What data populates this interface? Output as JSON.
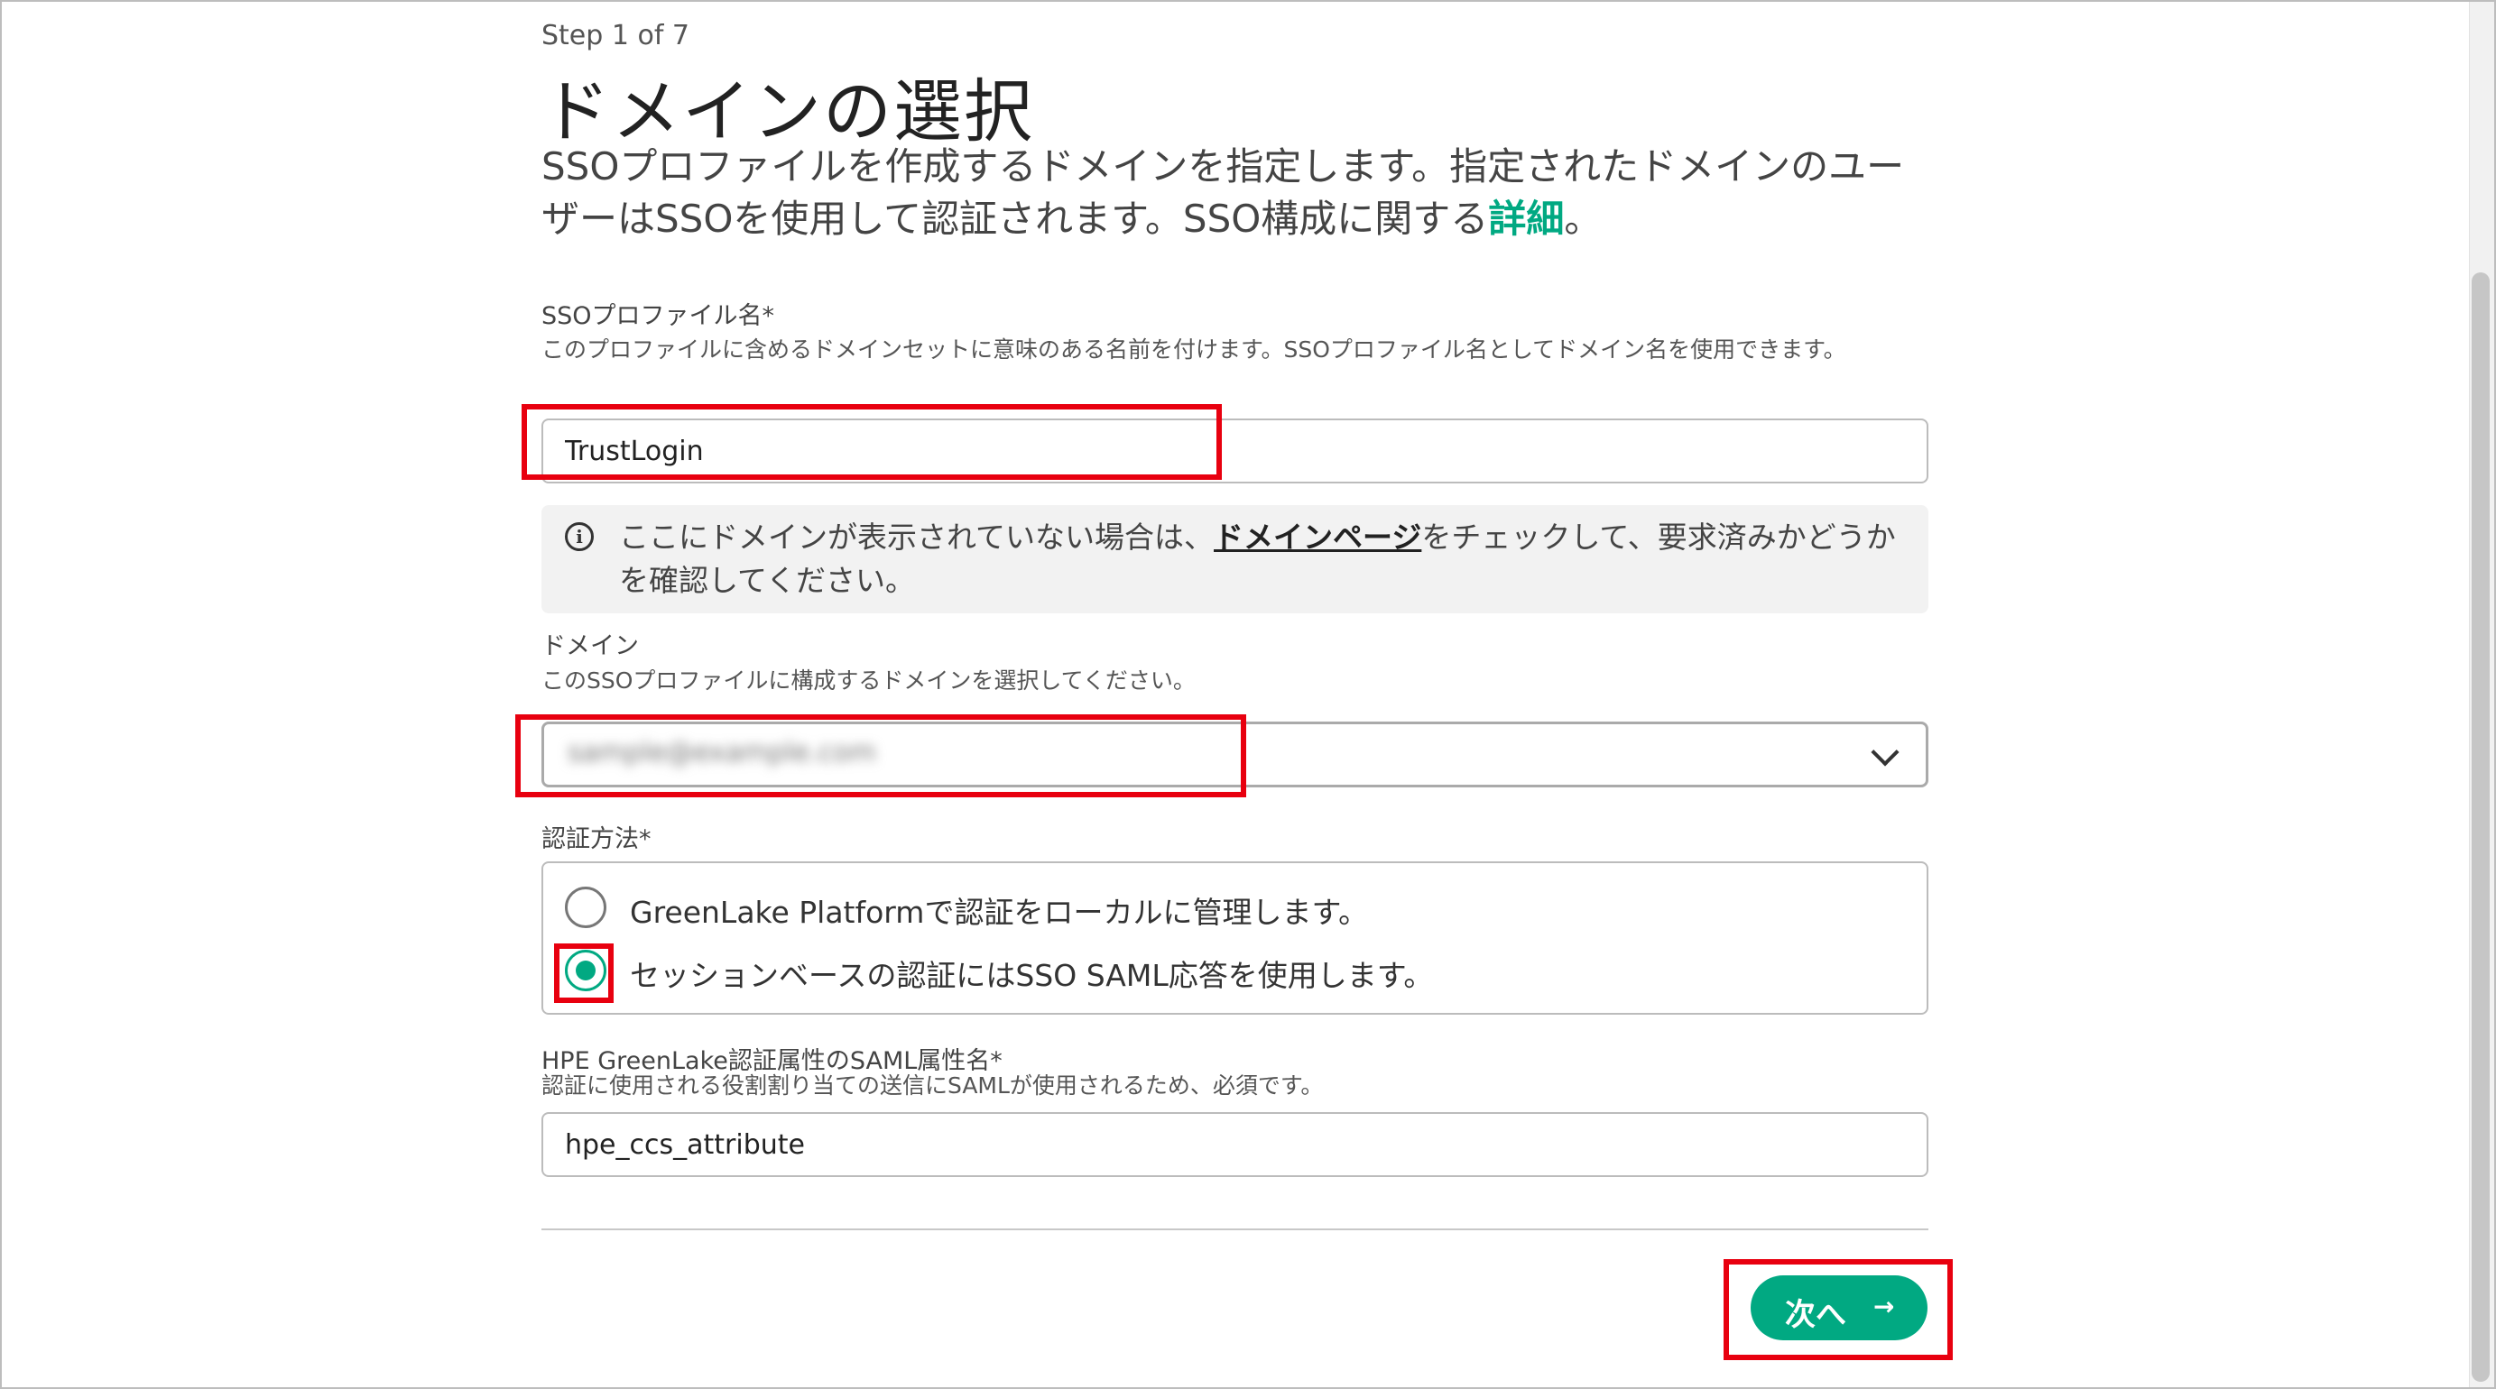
{
  "header": {
    "step": "Step 1 of 7",
    "title": "ドメインの選択",
    "description": "SSOプロファイルを作成するドメインを指定します。指定されたドメインのユーザーはSSOを使用して認証されます。SSO構成に関する",
    "description_link": "詳細",
    "description_end": "。"
  },
  "profile_name": {
    "label": "SSOプロファイル名*",
    "help": "このプロファイルに含めるドメインセットに意味のある名前を付けます。SSOプロファイル名としてドメイン名を使用できます。",
    "value": "TrustLogin"
  },
  "info_notice": {
    "text_before": "ここにドメインが表示されていない場合は、",
    "link": "ドメインページ",
    "text_after": "をチェックして、要求済みかどうかを確認してください。"
  },
  "domain": {
    "label": "ドメイン",
    "help": "このSSOプロファイルに構成するドメインを選択してください。",
    "selected_value": "sample@example.com"
  },
  "auth_method": {
    "label": "認証方法*",
    "options": [
      {
        "label": "GreenLake Platformで認証をローカルに管理します。",
        "selected": false
      },
      {
        "label": "セッションベースの認証にはSSO SAML応答を使用します。",
        "selected": true
      }
    ]
  },
  "saml_attribute": {
    "label": "HPE GreenLake認証属性のSAML属性名*",
    "help": "認証に使用される役割割り当ての送信にSAMLが使用されるため、必須です。",
    "value": "hpe_ccs_attribute"
  },
  "footer": {
    "next_label": "次へ",
    "next_icon": "arrow-right-icon"
  },
  "colors": {
    "accent": "#01a982",
    "highlight": "#e8000f"
  }
}
